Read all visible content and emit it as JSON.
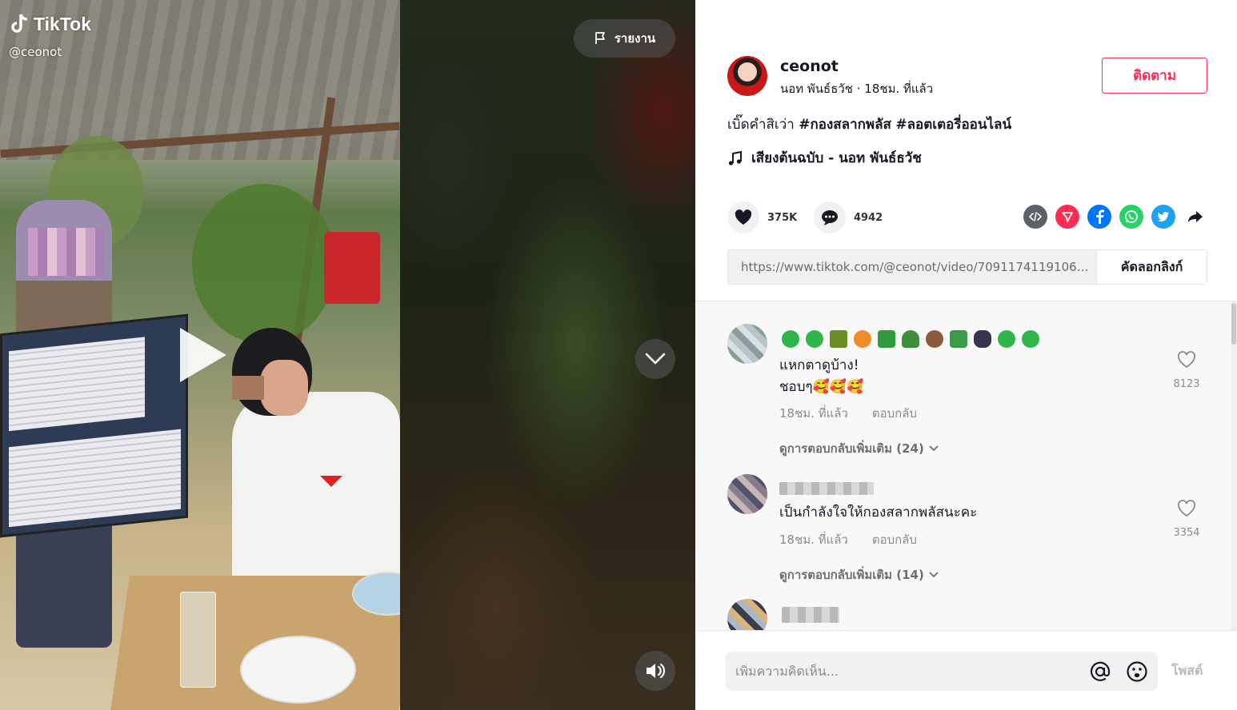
{
  "video": {
    "brand": "TikTok",
    "watermark_user": "@ceonot",
    "report_label": "รายงาน"
  },
  "author": {
    "username": "ceonot",
    "display_name": "นอท พันธ์ธวัช",
    "time": "18ชม. ที่แล้ว",
    "separator": " · ",
    "follow_label": "ติดตาม"
  },
  "post": {
    "caption_text": "เบิ๊ดคำสิเว่า ",
    "tag1": "#กองสลากพลัส",
    "tag2": "#ลอตเตอรี่ออนไลน์",
    "music": "เสียงต้นฉบับ - นอท พันธ์ธวัช",
    "likes": "375K",
    "comments": "4942",
    "link": "https://www.tiktok.com/@ceonot/video/709117411910600...",
    "copy_label": "คัดลอกลิงก์"
  },
  "colors": {
    "accent": "#fe2c55",
    "embed": "#5d6069",
    "telegram": "#fe2c55",
    "facebook": "#0075fa",
    "whatsapp": "#25d366",
    "twitter": "#1da1f2"
  },
  "comments_list": [
    {
      "line1": "แหกตาดูบ้าง!",
      "line2": "ชอบๆ🥰🥰🥰",
      "time": "18ชม. ที่แล้ว",
      "reply": "ตอบกลับ",
      "likes": "8123",
      "more": "ดูการตอบกลับเพิ่มเติม (24)"
    },
    {
      "line1": "เป็นกำลังใจให้กองสลากพลัสนะคะ",
      "time": "18ชม. ที่แล้ว",
      "reply": "ตอบกลับ",
      "likes": "3354",
      "more": "ดูการตอบกลับเพิ่มเติม (14)"
    }
  ],
  "composer": {
    "placeholder": "เพิ่มความคิดเห็น...",
    "post_label": "โพสต์"
  }
}
